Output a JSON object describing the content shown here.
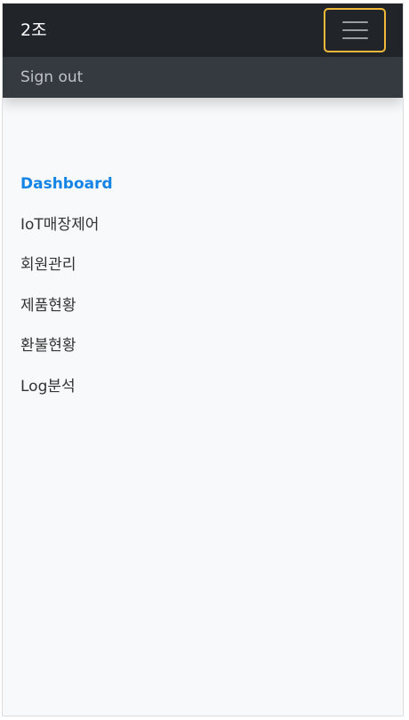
{
  "navbar": {
    "brand": "2조",
    "toggler_icon": "hamburger-menu-icon",
    "toggler_focus_color": "#f1b93a",
    "background": "#212529"
  },
  "signout": {
    "label": "Sign out",
    "background": "#343a40"
  },
  "sidebar": {
    "active_color": "#1484e6",
    "items": [
      {
        "label": "Dashboard",
        "active": true
      },
      {
        "label": "IoT매장제어",
        "active": false
      },
      {
        "label": "회원관리",
        "active": false
      },
      {
        "label": "제품현황",
        "active": false
      },
      {
        "label": "환불현황",
        "active": false
      },
      {
        "label": "Log분석",
        "active": false
      }
    ]
  }
}
